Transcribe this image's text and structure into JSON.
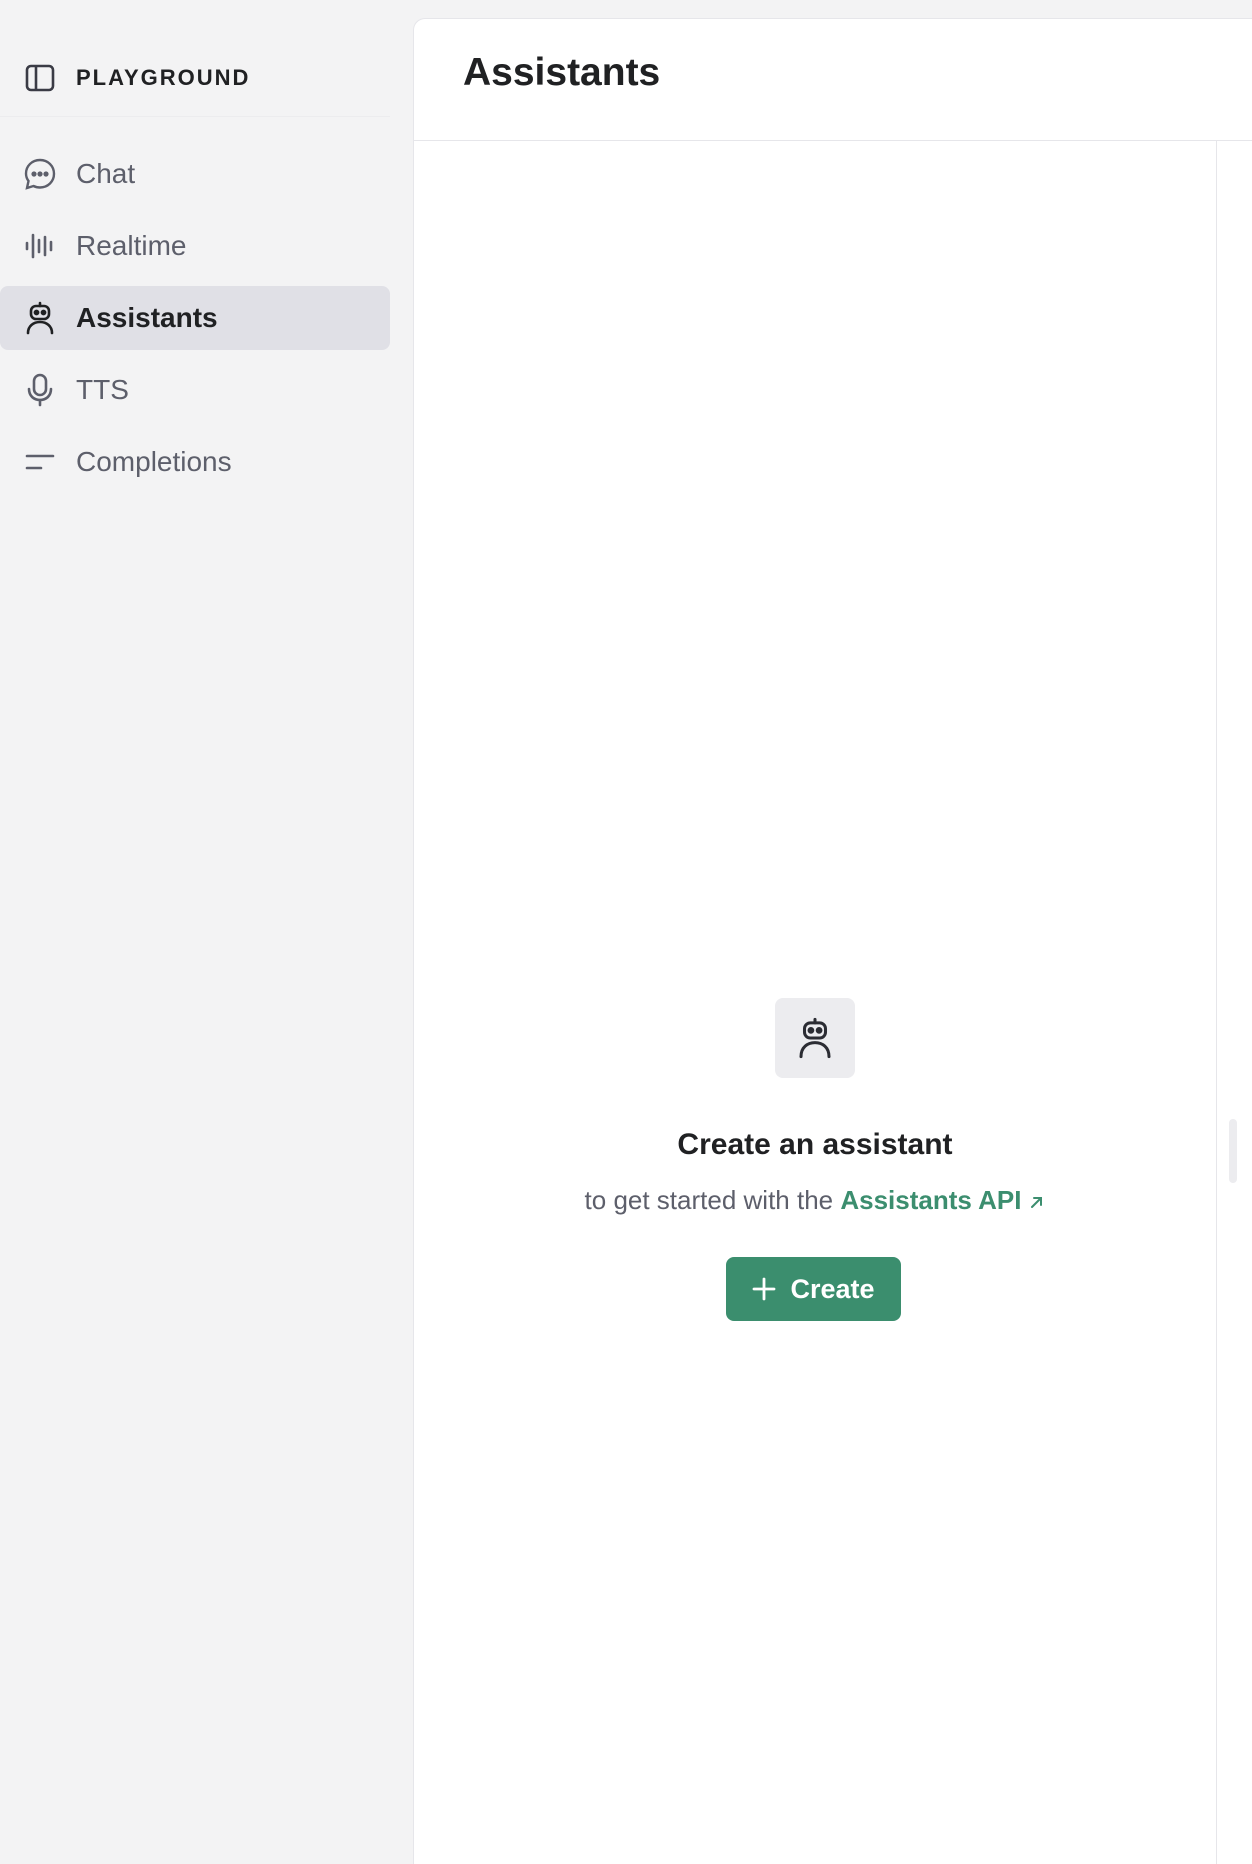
{
  "sidebar": {
    "brand": "PLAYGROUND",
    "items": [
      {
        "label": "Chat",
        "icon": "chat-bubble-icon",
        "active": false
      },
      {
        "label": "Realtime",
        "icon": "waveform-icon",
        "active": false
      },
      {
        "label": "Assistants",
        "icon": "robot-icon",
        "active": true
      },
      {
        "label": "TTS",
        "icon": "microphone-icon",
        "active": false
      },
      {
        "label": "Completions",
        "icon": "lines-icon",
        "active": false
      }
    ]
  },
  "main": {
    "title": "Assistants",
    "empty_state": {
      "icon": "robot-icon",
      "title": "Create an assistant",
      "subtitle_prefix": "to get started with the",
      "link_text": "Assistants API",
      "button_label": "Create"
    }
  },
  "colors": {
    "accent": "#3b8e6e",
    "active_nav_bg": "#e0e0e6",
    "sidebar_bg": "#f3f3f4"
  }
}
